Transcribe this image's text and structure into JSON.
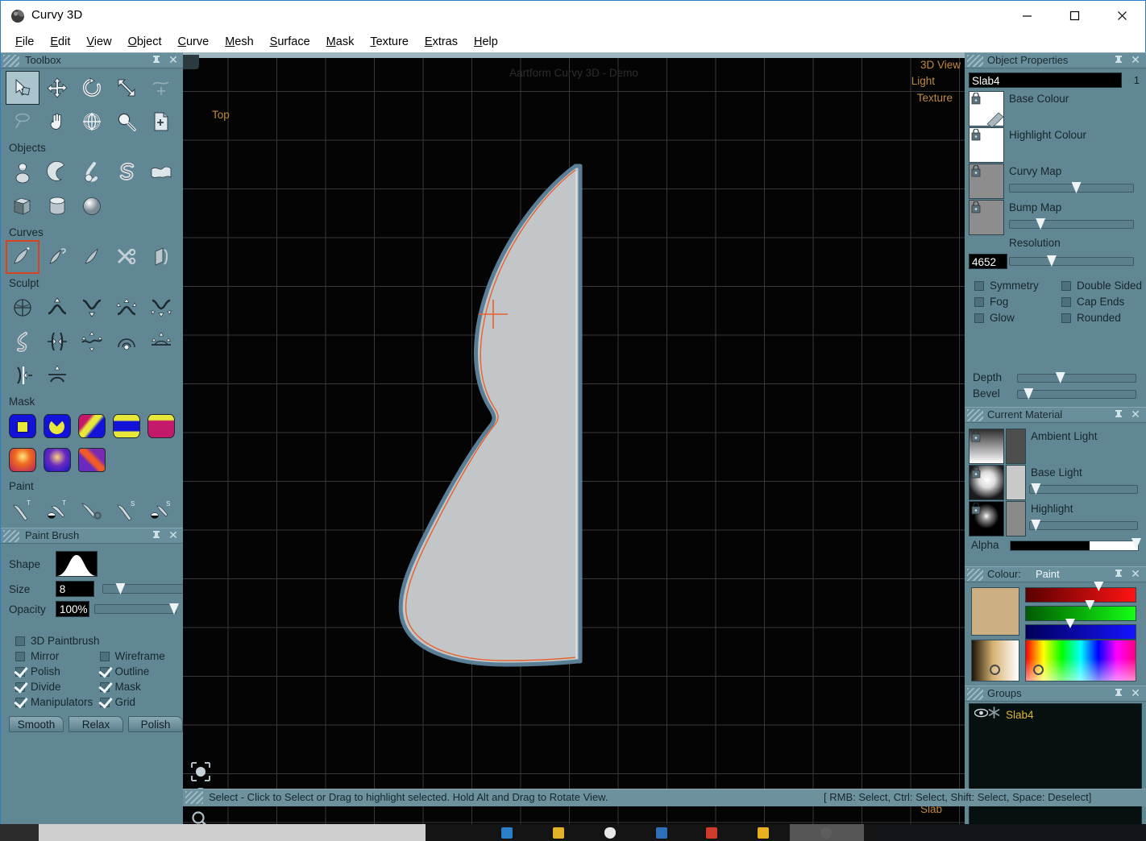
{
  "window": {
    "title": "Curvy 3D",
    "app_icon": "curvy-logo-icon",
    "minimize": "—",
    "maximize": "□",
    "close": "✕"
  },
  "menubar": {
    "items": [
      {
        "label": "File",
        "accel": "F"
      },
      {
        "label": "Edit",
        "accel": "E"
      },
      {
        "label": "View",
        "accel": "V"
      },
      {
        "label": "Object",
        "accel": "O"
      },
      {
        "label": "Curve",
        "accel": "C"
      },
      {
        "label": "Mesh",
        "accel": "M"
      },
      {
        "label": "Surface",
        "accel": "S"
      },
      {
        "label": "Mask",
        "accel": "M"
      },
      {
        "label": "Texture",
        "accel": "T"
      },
      {
        "label": "Extras",
        "accel": "E"
      },
      {
        "label": "Help",
        "accel": "H"
      }
    ]
  },
  "toolbox": {
    "title": "Toolbox",
    "sections": [
      {
        "label": "",
        "rows": [
          [
            "select-tool",
            "move-tool",
            "rotate-tool",
            "scale-tool",
            "deform-tool"
          ],
          [
            "lasso-tool",
            "pan-tool",
            "orbit-tool",
            "zoom-tool",
            "new-page-tool"
          ]
        ]
      },
      {
        "label": "Objects",
        "rows": [
          [
            "lathe-object",
            "crescent-object",
            "tube-object",
            "spiral-object",
            "cloth-object"
          ],
          [
            "box-object",
            "cylinder-object",
            "sphere-object"
          ]
        ]
      },
      {
        "label": "Curves",
        "rows": [
          [
            "draw-curve",
            "edit-curve",
            "trim-curve",
            "cut-curve",
            "slice-curve"
          ]
        ]
      },
      {
        "label": "Sculpt",
        "rows": [
          [
            "inflate-all-tool",
            "bump-up-tool",
            "bump-down-tool",
            "expand-tool",
            "contract-tool"
          ],
          [
            "twist-tool",
            "pinch-tool",
            "smooth-tool",
            "dome-tool",
            "flatten-tool"
          ],
          [
            "half-pinch-tool",
            "crease-tool"
          ]
        ]
      },
      {
        "label": "Mask",
        "rows": [
          [
            "mask-square",
            "mask-circle-cut",
            "mask-diagonal",
            "mask-band",
            "mask-solid"
          ],
          [
            "mask-radial-warm",
            "mask-radial-cool",
            "mask-cross"
          ]
        ]
      },
      {
        "label": "Paint",
        "rows": [
          [
            "paint-texture-brush",
            "paint-texture-blob",
            "paint-texture-eraser",
            "paint-surface-brush",
            "paint-surface-blob"
          ]
        ]
      }
    ],
    "selected_tool": "select-tool",
    "highlighted_tool": "draw-curve"
  },
  "paint_brush": {
    "title": "Paint Brush",
    "shape_label": "Shape",
    "shape_preview": "bell-curve-icon",
    "size_label": "Size",
    "size_value": "8",
    "opacity_label": "Opacity",
    "opacity_value": "100%",
    "options": [
      {
        "label": "3D Paintbrush",
        "checked": false
      },
      {
        "label": "Mirror",
        "checked": false
      },
      {
        "label": "Wireframe",
        "checked": false
      },
      {
        "label": "Polish",
        "checked": true
      },
      {
        "label": "Outline",
        "checked": true
      },
      {
        "label": "Divide",
        "checked": true
      },
      {
        "label": "Mask",
        "checked": true
      },
      {
        "label": "Manipulators",
        "checked": true
      },
      {
        "label": "Grid",
        "checked": true
      }
    ],
    "buttons": [
      "Smooth",
      "Relax",
      "Polish"
    ]
  },
  "viewport": {
    "view_label": "Top",
    "watermark": "Aartform Curvy 3D - Demo",
    "corner_labels": [
      "3D View",
      "Light",
      "Texture"
    ],
    "object_label": "Slab",
    "accent_label_color": "#c08a3e",
    "tools": [
      "light-ball-icon",
      "pan-target-icon",
      "zoom-magnifier-icon"
    ],
    "shape": {
      "fill_color": "#c2c6c9",
      "outline_color": "#5a7e95",
      "curve_color": "#e8622f",
      "cursor": "crosshair-marker"
    }
  },
  "object_properties": {
    "title": "Object Properties",
    "name_value": "Slab4",
    "name_index": "1",
    "maps": [
      {
        "label": "Base Colour",
        "swatch": "#ffffff"
      },
      {
        "label": "Highlight Colour",
        "swatch": "#ffffff"
      },
      {
        "label": "Curvy Map",
        "swatch": "#8d8d8d",
        "slider": 52
      },
      {
        "label": "Bump Map",
        "swatch": "#8d8d8d",
        "slider": 23
      }
    ],
    "resolution_label": "Resolution",
    "resolution_value": "4652",
    "resolution_slider": 32,
    "checkboxes": [
      {
        "label": "Symmetry",
        "checked": false
      },
      {
        "label": "Double Sided",
        "checked": false
      },
      {
        "label": "Fog",
        "checked": false
      },
      {
        "label": "Cap Ends",
        "checked": false
      },
      {
        "label": "Glow",
        "checked": false
      },
      {
        "label": "Rounded",
        "checked": false
      }
    ],
    "depth_label": "Depth",
    "depth_slider": 33,
    "bevel_label": "Bevel",
    "bevel_slider": 5
  },
  "current_material": {
    "title": "Current Material",
    "rows": [
      {
        "label": "Ambient Light",
        "swatch": "ambient-gradient",
        "color": "#4e4e4e",
        "slider": null
      },
      {
        "label": "Base Light",
        "swatch": "sphere-light",
        "color": "#c9c9c9",
        "slider": 2
      },
      {
        "label": "Highlight",
        "swatch": "specular-dot",
        "color": "#8a8a8a",
        "slider": 2
      }
    ],
    "alpha_label": "Alpha",
    "alpha_value": 62
  },
  "colour_panel": {
    "title_label": "Colour:",
    "mode_label": "Paint",
    "current_swatch": "#cdb081",
    "channels": [
      {
        "name": "red-channel",
        "from": "#5a0000",
        "to": "#ff1414",
        "thumb": 62
      },
      {
        "name": "green-channel",
        "from": "#005a00",
        "to": "#14ff14",
        "thumb": 54
      },
      {
        "name": "blue-channel",
        "from": "#00005a",
        "to": "#1414ff",
        "thumb": 36
      }
    ],
    "value_box": "value-gradient-box",
    "hue_box": "hue-saturation-box"
  },
  "groups": {
    "title": "Groups",
    "items": [
      {
        "name": "Slab4",
        "visible_icon": "eye-icon",
        "type_icon": "star-icon",
        "color": "#e2b13c"
      }
    ]
  },
  "statusbar": {
    "text": "Select - Click to Select or Drag to highlight selected. Hold Alt and Drag to Rotate View.",
    "keys": "[ RMB: Select, Ctrl: Select, Shift: Select, Space: Deselect]"
  }
}
